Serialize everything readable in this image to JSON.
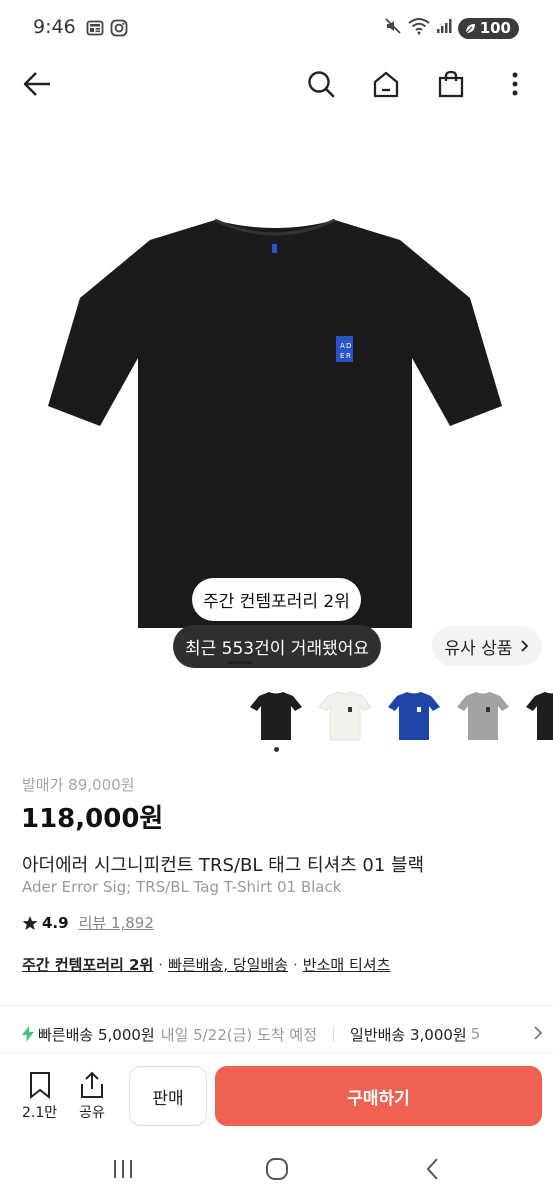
{
  "status_bar": {
    "time": "9:46",
    "battery": "100"
  },
  "app_bar": {
    "icons": [
      "back-arrow-icon",
      "search-icon",
      "home-icon",
      "shopping-bag-icon",
      "more-vertical-icon"
    ]
  },
  "hero": {
    "rank_pill": "주간 컨템포러리 2위",
    "recent_pill": "최근 553건이 거래됐어요",
    "similar_button": "유사 상품"
  },
  "thumbnails": {
    "colors": [
      "#1e1e1e",
      "#f2f1ec",
      "#1f45a8",
      "#a3a3a3",
      "#1e1e1e"
    ],
    "selected_index": 0
  },
  "product": {
    "msrp": "발매가 89,000원",
    "price": "118,000원",
    "name_ko": "아더에러 시그니피컨트 TRS/BL 태그 티셔츠 01 블랙",
    "name_en": "Ader Error Sig; TRS/BL Tag T-Shirt 01 Black",
    "rating": "4.9",
    "reviews": "리뷰 1,892",
    "tags": [
      "주간 컨템포러리 2위",
      "빠른배송, 당일배송",
      "반소매 티셔츠"
    ]
  },
  "shipping": {
    "fast": "빠른배송 5,000원",
    "eta": "내일 5/22(금) 도착 예정",
    "normal": "일반배송 3,000원",
    "normal_suffix": "5"
  },
  "bottom_bar": {
    "wish_count": "2.1만",
    "share_label": "공유",
    "sell_label": "판매",
    "buy_label": "구매하기"
  },
  "colors": {
    "accent": "#ef6253",
    "fast_bolt": "#3cc47c",
    "logo_blue": "#2a55c8"
  }
}
